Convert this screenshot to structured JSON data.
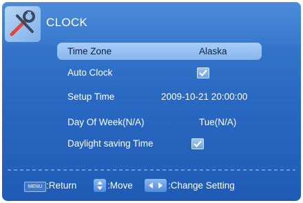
{
  "header": {
    "title": "CLOCK",
    "icon": "tools-icon"
  },
  "settings": {
    "time_zone": {
      "label": "Time Zone",
      "value": "Alaska"
    },
    "auto_clock": {
      "label": "Auto Clock",
      "checked": true
    },
    "setup_time": {
      "label": "Setup Time",
      "value": "2009-10-21 20:00:00"
    },
    "day_of_week": {
      "label": "Day Of Week(N/A)",
      "value": "Tue(N/A)"
    },
    "daylight_saving": {
      "label": "Daylight saving Time",
      "checked": true
    }
  },
  "footer": {
    "menu_key": "MENU",
    "return_label": ":Return",
    "move_label": ":Move",
    "change_label": ":Change Setting"
  },
  "colors": {
    "background": "#2a6ac3",
    "highlight": "#a9cdf6",
    "text": "#ffffff"
  }
}
